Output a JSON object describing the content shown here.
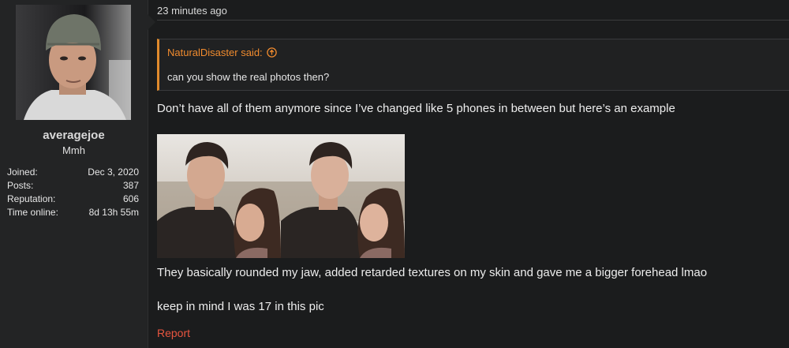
{
  "user": {
    "name": "averagejoe",
    "title": "Mmh",
    "stats": [
      {
        "label": "Joined:",
        "value": "Dec 3, 2020"
      },
      {
        "label": "Posts:",
        "value": "387"
      },
      {
        "label": "Reputation:",
        "value": "606"
      },
      {
        "label": "Time online:",
        "value": "8d 13h 55m"
      }
    ]
  },
  "post": {
    "timestamp": "23 minutes ago",
    "quote": {
      "author": "NaturalDisaster said:",
      "icon": "arrow-up-circle-icon",
      "text": "can you show the real photos then?"
    },
    "paragraphs": [
      "Don’t have all of them anymore since I’ve changed like 5 phones in between but here’s an example",
      "They basically rounded my jaw, added retarded textures on my skin and gave me a bigger forehead lmao",
      "keep in mind I was 17 in this pic"
    ],
    "report_label": "Report"
  },
  "colors": {
    "background": "#1b1c1d",
    "panel": "#232425",
    "quote_accent": "#e08a2c",
    "quote_author": "#f08b2e",
    "report": "#e8553f"
  }
}
